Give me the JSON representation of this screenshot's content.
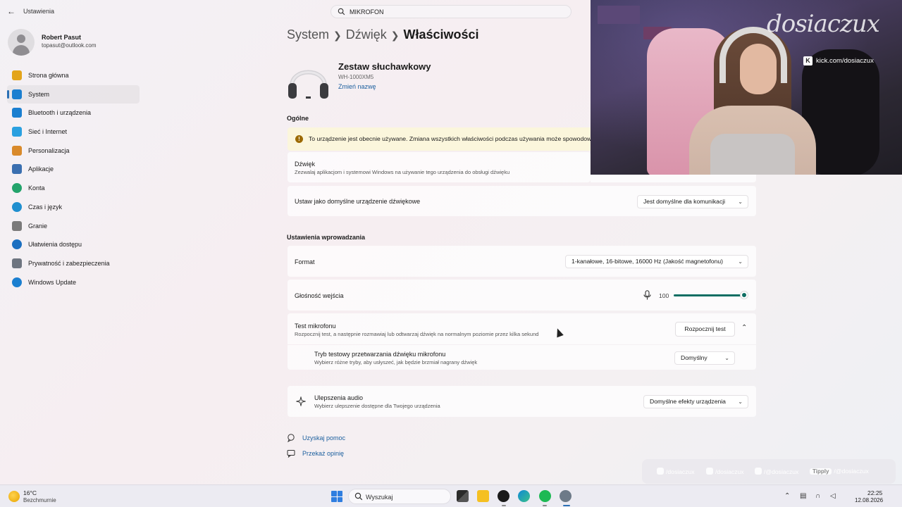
{
  "app": {
    "title": "Ustawienia"
  },
  "search": {
    "value": "MIKROFON"
  },
  "user": {
    "name": "Robert Pasut",
    "email": "topasut@outlook.com"
  },
  "sidebar": {
    "items": [
      {
        "label": "Strona główna",
        "icon": "home-icon",
        "color": "#e3a41a"
      },
      {
        "label": "System",
        "icon": "monitor-icon",
        "color": "#1b7fd0"
      },
      {
        "label": "Bluetooth i urządzenia",
        "icon": "bluetooth-icon",
        "color": "#1b7fd0"
      },
      {
        "label": "Sieć i Internet",
        "icon": "wifi-icon",
        "color": "#2aa0e0"
      },
      {
        "label": "Personalizacja",
        "icon": "brush-icon",
        "color": "#d98a2b"
      },
      {
        "label": "Aplikacje",
        "icon": "apps-icon",
        "color": "#3a6fb0"
      },
      {
        "label": "Konta",
        "icon": "person-icon",
        "color": "#23a36b"
      },
      {
        "label": "Czas i język",
        "icon": "globe-clock-icon",
        "color": "#1f8fcf"
      },
      {
        "label": "Granie",
        "icon": "gamepad-icon",
        "color": "#7a7a7a"
      },
      {
        "label": "Ułatwienia dostępu",
        "icon": "accessibility-icon",
        "color": "#1b6fc0"
      },
      {
        "label": "Prywatność i zabezpieczenia",
        "icon": "shield-icon",
        "color": "#6e7580"
      },
      {
        "label": "Windows Update",
        "icon": "update-icon",
        "color": "#1b7fd0"
      }
    ],
    "active_index": 1
  },
  "breadcrumb": {
    "part1": "System",
    "part2": "Dźwięk",
    "current": "Właściwości"
  },
  "device": {
    "name": "Zestaw słuchawkowy",
    "model": "WH-1000XM5",
    "rename_link": "Zmień nazwę"
  },
  "general": {
    "section_title": "Ogólne",
    "warning": "To urządzenie jest obecnie używane. Zmiana wszystkich właściwości podczas używania może spowodować",
    "audio": {
      "label": "Dźwięk",
      "desc": "Zezwalaj aplikacjom i systemowi Windows na używanie tego urządzenia do obsługi dźwięku"
    },
    "default_device": {
      "label": "Ustaw jako domyślne urządzenie dźwiękowe",
      "value": "Jest domyślne dla komunikacji"
    }
  },
  "input": {
    "section_title": "Ustawienia wprowadzania",
    "format": {
      "label": "Format",
      "value": "1-kanałowe, 16-bitowe, 16000 Hz (Jakość magnetofonu)"
    },
    "volume": {
      "label": "Głośność wejścia",
      "value": "100",
      "level_percent": 100
    },
    "mic_test": {
      "label": "Test mikrofonu",
      "desc": "Rozpocznij test, a następnie rozmawiaj lub odtwarzaj dźwięk na normalnym poziomie przez kilka sekund",
      "button": "Rozpocznij test"
    },
    "test_mode": {
      "label": "Tryb testowy przetwarzania dźwięku mikrofonu",
      "desc": "Wybierz różne tryby, aby usłyszeć, jak będzie brzmiał nagrany dźwięk",
      "value": "Domyślny"
    },
    "enhancements": {
      "label": "Ulepszenia audio",
      "desc": "Wybierz ulepszenie dostępne dla Twojego urządzenia",
      "value": "Domyślne efekty urządzenia"
    }
  },
  "help": {
    "get_help": "Uzyskaj pomoc",
    "feedback": "Przekaż opinię"
  },
  "overlay": {
    "brand": "dosiaczux",
    "kick": "kick.com/dosiaczux",
    "socials": [
      "/dosiaczux",
      "/dosiaczux",
      "/@dosiaczux",
      "/@dosiaczux"
    ],
    "tipply": "Tipply"
  },
  "taskbar": {
    "weather_temp": "16°C",
    "weather_desc": "Bezchmurnie",
    "search_label": "Wyszukaj",
    "time": "22:25",
    "date": "12.08.2026"
  }
}
